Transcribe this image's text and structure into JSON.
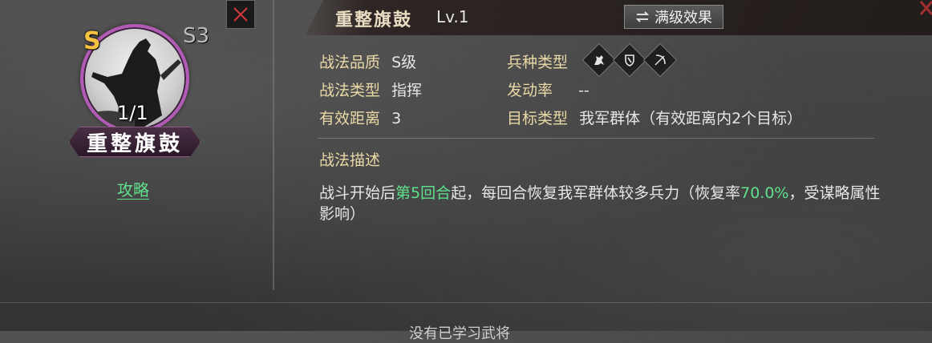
{
  "close_icon": "close-x-icon",
  "hero": {
    "grade": "S",
    "level_badge": "S3",
    "count": "1/1",
    "name": "重整旗鼓",
    "guide_link": "攻略",
    "ring_color": "#b25bb6"
  },
  "header": {
    "title": "重整旗鼓",
    "level": "Lv.1",
    "max_effect_button": "满级效果",
    "max_effect_icon": "swap-arrows-icon"
  },
  "stats": {
    "quality_label": "战法品质",
    "quality_value": "S级",
    "type_label": "战法类型",
    "type_value": "指挥",
    "range_label": "有效距离",
    "range_value": "3",
    "troop_label": "兵种类型",
    "troop_icons": [
      "cavalry-icon",
      "shield-icon",
      "bow-icon"
    ],
    "rate_label": "发动率",
    "rate_value": "--",
    "target_label": "目标类型",
    "target_value": "我军群体（有效距离内2个目标）"
  },
  "description": {
    "title": "战法描述",
    "text_part1": "战斗开始后",
    "highlight1": "第5回合",
    "text_part2": "起，每回合恢复我军群体较多兵力（恢复率",
    "highlight2": "70.0%",
    "text_part3": "，受谋略属性影响）",
    "highlight_color": "#5fe08b"
  },
  "footer": {
    "partial_text": "没有已学习武将"
  }
}
